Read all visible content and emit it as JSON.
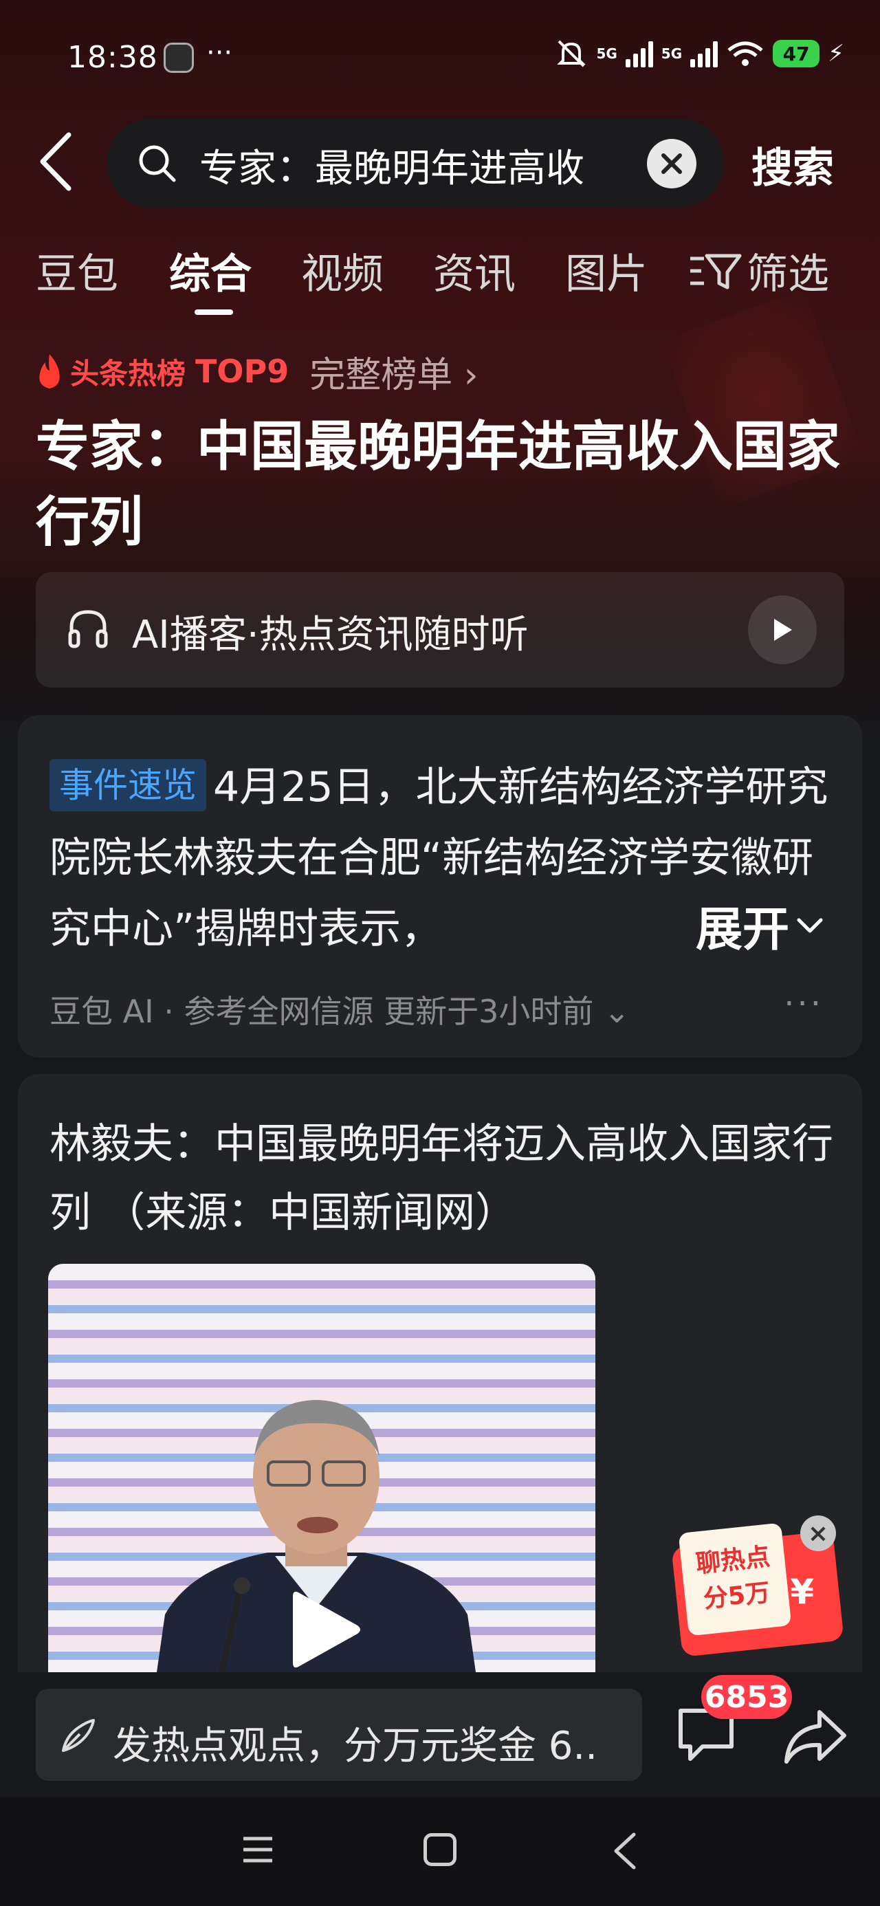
{
  "status_bar": {
    "time": "18:38",
    "dots": "···",
    "network_1": "5G",
    "network_2": "5G",
    "battery": "47"
  },
  "search": {
    "query": "专家：最晚明年进高收",
    "button_label": "搜索"
  },
  "tabs": [
    {
      "label": "豆包"
    },
    {
      "label": "综合",
      "active": true
    },
    {
      "label": "视频"
    },
    {
      "label": "资讯"
    },
    {
      "label": "图片"
    }
  ],
  "filter_label": "筛选",
  "hot": {
    "label": "头条热榜",
    "rank": "TOP9",
    "more": "完整榜单 ›",
    "title": "专家：中国最晚明年进高收入国家行列"
  },
  "podcast": {
    "label": "AI播客·热点资讯随时听"
  },
  "summary_card": {
    "badge": "事件速览",
    "text": "4月25日，北大新结构经济学研究院院长林毅夫在合肥“新结构经济学安徽研究中心”揭牌时表示，",
    "expand": "展开",
    "meta": "豆包 AI · 参考全网信源  更新于3小时前 ⌄",
    "more": "···"
  },
  "news_card": {
    "title": "林毅夫：中国最晚明年将迈入高收入国家行列 （来源：中国新闻网）"
  },
  "red_packet": {
    "line1": "聊热点",
    "line2": "分5万",
    "symbol": "¥",
    "close": "×"
  },
  "bottom_bar": {
    "comment_placeholder": "发热点观点，分万元奖金 6..",
    "comment_count": "6853"
  },
  "colors": {
    "accent_red": "#ff4b4b",
    "badge_blue": "#4aa6ff",
    "battery_green": "#3ad14c",
    "card_bg": "#222326"
  }
}
